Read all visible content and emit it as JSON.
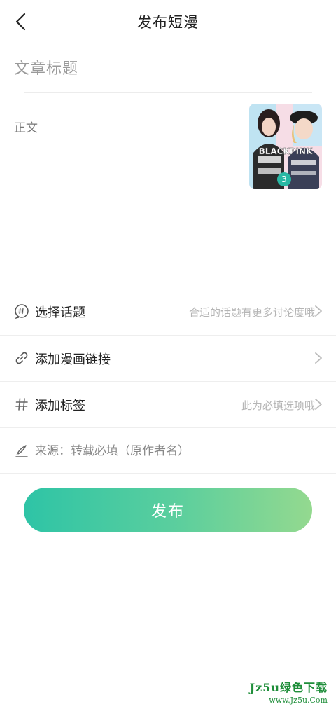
{
  "header": {
    "title": "发布短漫",
    "back_icon": "chevron-left-icon"
  },
  "editor": {
    "title_placeholder": "文章标题",
    "body_placeholder": "正文",
    "image_count": "3",
    "image_text": "BLACKPINK"
  },
  "options": {
    "topic": {
      "label": "选择话题",
      "hint": "合适的话题有更多讨论度哦",
      "icon": "hash-bubble-icon"
    },
    "link": {
      "label": "添加漫画链接",
      "icon": "link-icon"
    },
    "tag": {
      "label": "添加标签",
      "hint": "此为必填选项哦",
      "icon": "hash-icon"
    },
    "source": {
      "placeholder": "来源：转载必填（原作者名）",
      "icon": "pen-icon"
    }
  },
  "publish_button": {
    "label": "发布"
  },
  "watermark": {
    "main": "Jz5u绿色下载",
    "url": "www.Jz5u.Com"
  },
  "colors": {
    "accent_start": "#2ec4a6",
    "accent_end": "#94d98f",
    "badge": "#29b8a4"
  }
}
